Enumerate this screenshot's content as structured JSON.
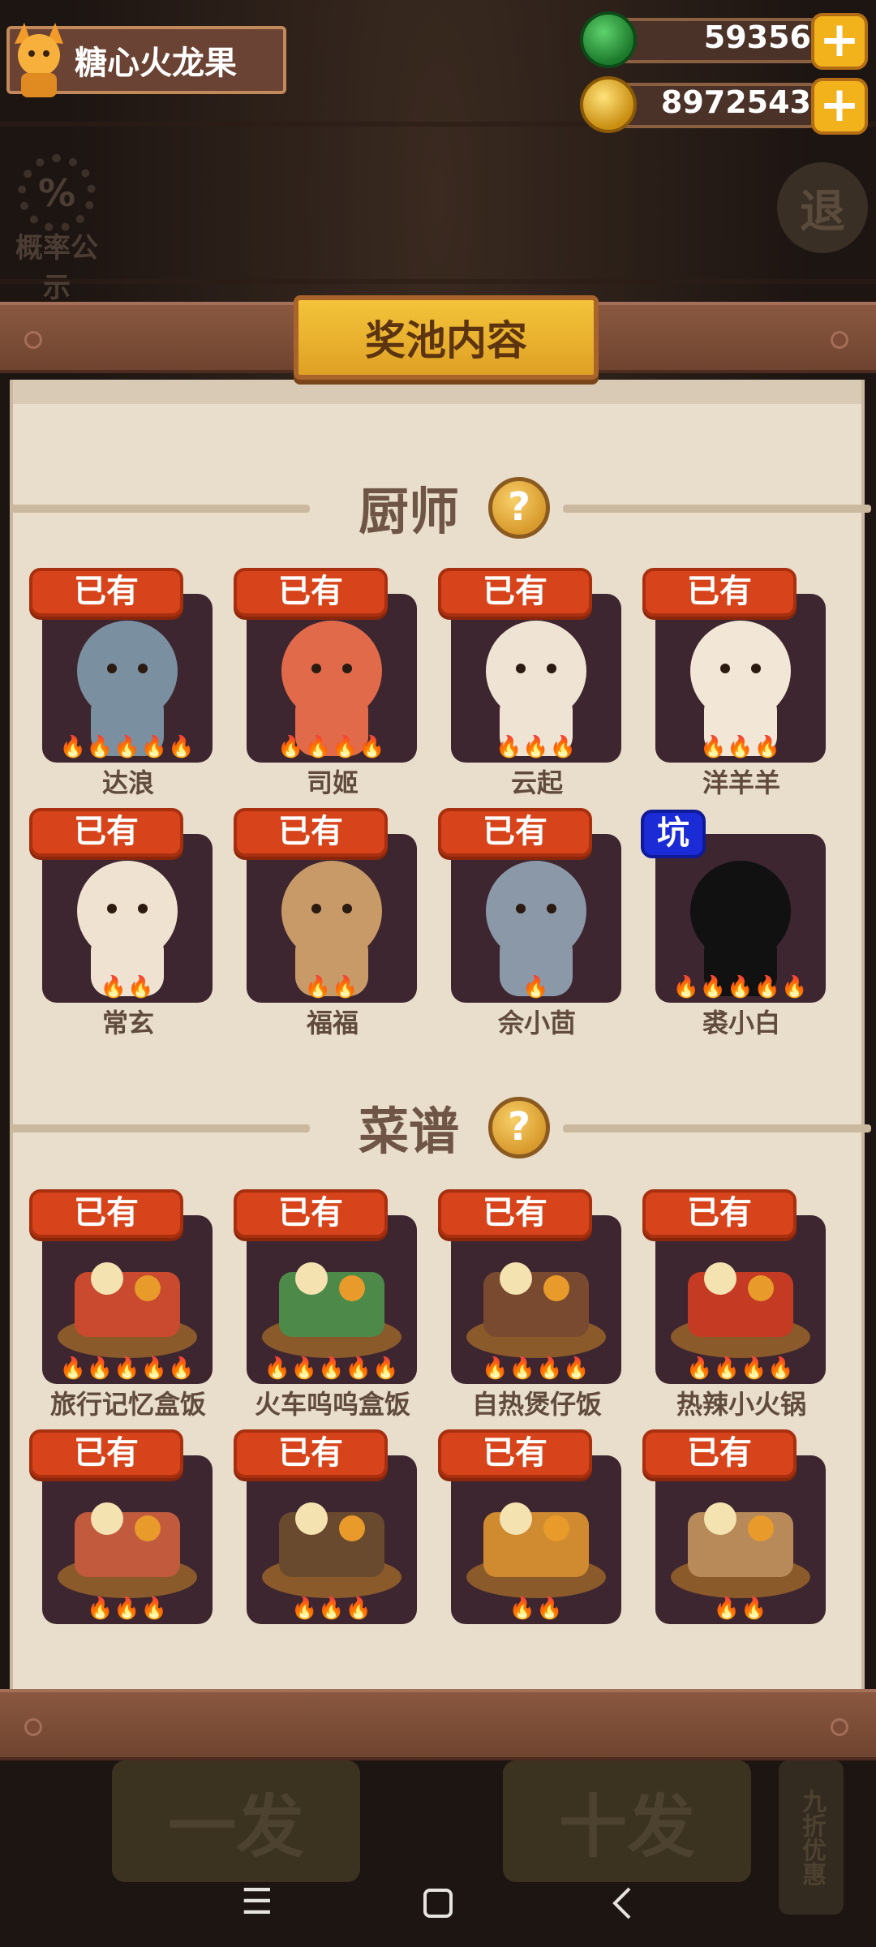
{
  "player": {
    "name": "糖心火龙果"
  },
  "currencies": {
    "jade": {
      "value": "59356",
      "icon": "jade-icon"
    },
    "coins": {
      "value": "8972543",
      "icon": "coin-icon"
    }
  },
  "background": {
    "rate_label": "概率公示",
    "rate_symbol": "%",
    "exit_label": "退",
    "draw_one": "一发",
    "draw_ten": "十发",
    "discount": "九折优惠"
  },
  "modal": {
    "title": "奖池内容",
    "chefs_section": {
      "label": "厨师",
      "help": "?"
    },
    "recipes_section": {
      "label": "菜谱",
      "help": "?"
    },
    "chefs": [
      {
        "name": "达浪",
        "badge": "已有",
        "stars": 5
      },
      {
        "name": "司姬",
        "badge": "已有",
        "stars": 4
      },
      {
        "name": "云起",
        "badge": "已有",
        "stars": 3
      },
      {
        "name": "洋羊羊",
        "badge": "已有",
        "stars": 3
      },
      {
        "name": "常玄",
        "badge": "已有",
        "stars": 2
      },
      {
        "name": "福福",
        "badge": "已有",
        "stars": 2
      },
      {
        "name": "佘小茴",
        "badge": "已有",
        "stars": 1
      },
      {
        "name": "裘小白",
        "badge": "坑",
        "stars": 5
      }
    ],
    "recipes": [
      {
        "name": "旅行记忆盒饭",
        "badge": "已有",
        "stars": 5
      },
      {
        "name": "火车呜呜盒饭",
        "badge": "已有",
        "stars": 5
      },
      {
        "name": "自热煲仔饭",
        "badge": "已有",
        "stars": 4
      },
      {
        "name": "热辣小火锅",
        "badge": "已有",
        "stars": 4
      },
      {
        "name": "",
        "badge": "已有",
        "stars": 3
      },
      {
        "name": "",
        "badge": "已有",
        "stars": 3
      },
      {
        "name": "",
        "badge": "已有",
        "stars": 2
      },
      {
        "name": "",
        "badge": "已有",
        "stars": 2
      }
    ]
  },
  "navbar": {
    "menu_icon": "menu-icon",
    "home_icon": "home-icon",
    "back_icon": "back-icon"
  },
  "colors": {
    "badge_owned": "#d7441b",
    "badge_pit": "#1b2bd6",
    "panel": "#e9ddcb",
    "card": "#3d2630"
  }
}
